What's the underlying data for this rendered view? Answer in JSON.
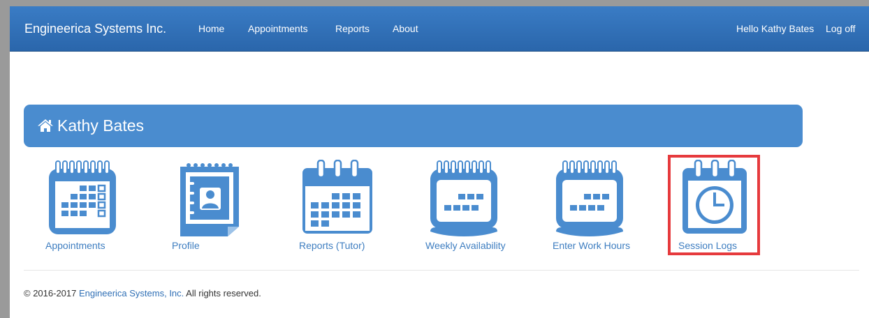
{
  "navbar": {
    "brand": "Engineerica Systems Inc.",
    "links": [
      "Home",
      "Appointments",
      "Reports",
      "About"
    ],
    "greeting": "Hello Kathy Bates",
    "logoff": "Log off"
  },
  "panel": {
    "title": "Kathy Bates",
    "icon": "home-icon"
  },
  "tiles": [
    {
      "label": "Appointments",
      "icon": "calendar-grid-icon"
    },
    {
      "label": "Profile",
      "icon": "contact-book-icon"
    },
    {
      "label": "Reports (Tutor)",
      "icon": "calendar-icon"
    },
    {
      "label": "Weekly Availability",
      "icon": "calendar-week-icon"
    },
    {
      "label": "Enter Work Hours",
      "icon": "calendar-week-icon"
    },
    {
      "label": "Session Logs",
      "icon": "calendar-clock-icon"
    }
  ],
  "highlight_color": "#e63a3d",
  "brand_color": "#2f6fb5",
  "footer": {
    "prefix": "© 2016-2017 ",
    "link": "Engineerica Systems, Inc.",
    "suffix": " All rights reserved."
  }
}
